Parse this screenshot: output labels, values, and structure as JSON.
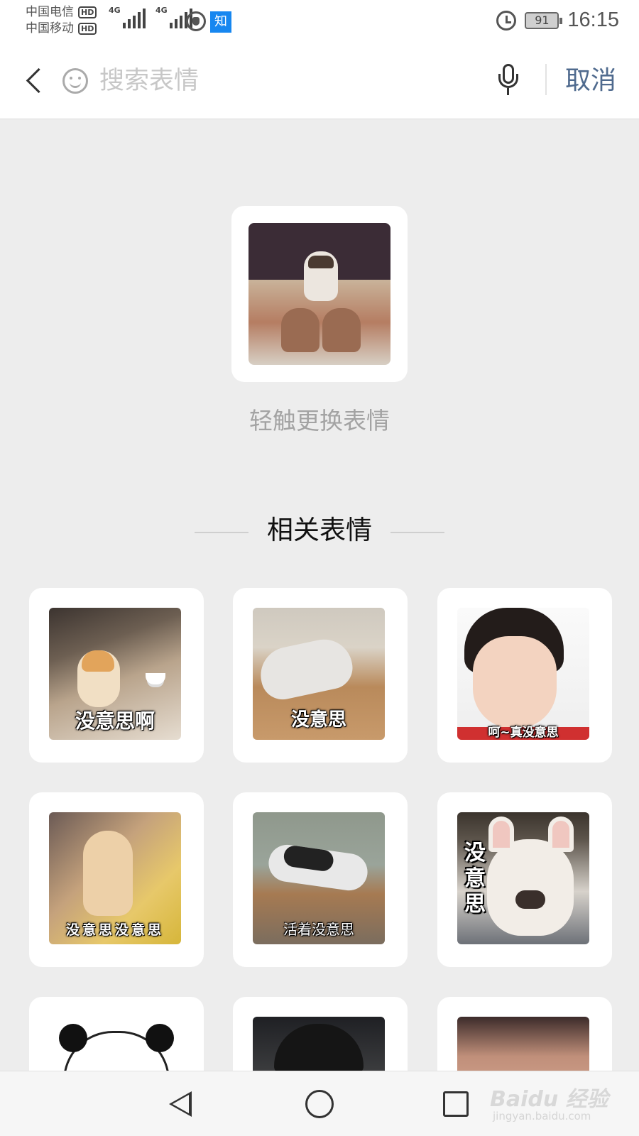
{
  "status_bar": {
    "carrier_1": "中国电信",
    "carrier_2": "中国移动",
    "hd_badge": "HD",
    "network_1": "4G",
    "network_2": "4G",
    "app_badge": "知",
    "battery_level": "91",
    "time": "16:15"
  },
  "search": {
    "placeholder": "搜索表情",
    "value": "",
    "cancel_label": "取消"
  },
  "hero": {
    "hint": "轻触更换表情",
    "image_caption": ""
  },
  "related": {
    "title": "相关表情",
    "items": [
      {
        "caption": "没意思啊"
      },
      {
        "caption": "没意思"
      },
      {
        "caption": "呵~真没意思"
      },
      {
        "caption": "没意思没意思"
      },
      {
        "caption": "活着没意思"
      },
      {
        "caption": "没意思"
      },
      {
        "caption": ""
      },
      {
        "caption": ""
      },
      {
        "caption": ""
      }
    ]
  },
  "watermark": {
    "brand": "Baidu 经验",
    "url": "jingyan.baidu.com"
  },
  "colors": {
    "accent_cancel": "#4f6a8e",
    "background": "#ededed",
    "app_badge_blue": "#1787f0"
  }
}
